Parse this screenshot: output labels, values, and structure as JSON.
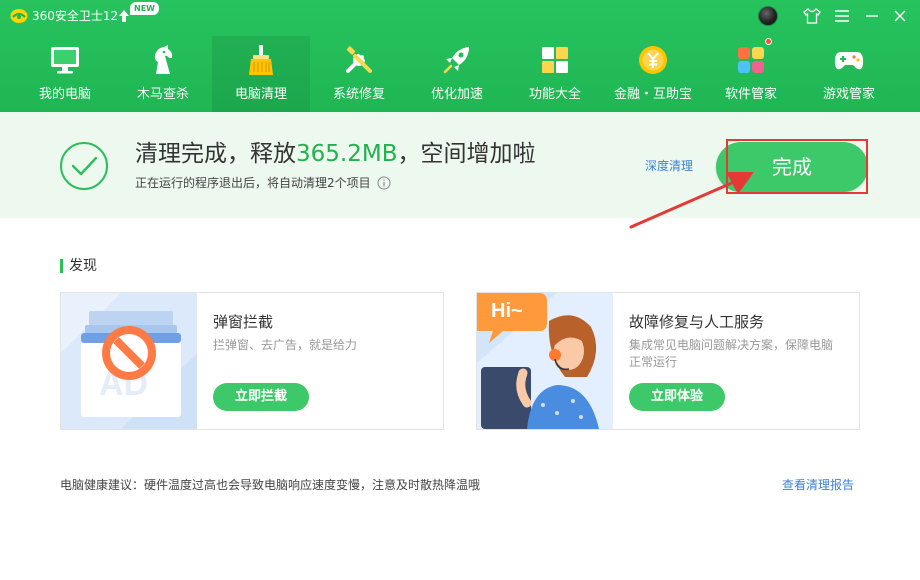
{
  "titlebar": {
    "app_title": "360安全卫士12",
    "new_badge": "NEW",
    "icons": [
      "logo-icon",
      "upgrade-icon",
      "avatar",
      "skin-icon",
      "menu-icon",
      "minimize-icon",
      "close-icon"
    ]
  },
  "nav": {
    "items": [
      {
        "label": "我的电脑",
        "icon": "computer-icon"
      },
      {
        "label": "木马查杀",
        "icon": "horse-icon"
      },
      {
        "label": "电脑清理",
        "icon": "broom-icon",
        "active": true
      },
      {
        "label": "系统修复",
        "icon": "tools-icon"
      },
      {
        "label": "优化加速",
        "icon": "rocket-icon"
      },
      {
        "label": "功能大全",
        "icon": "grid-icon"
      },
      {
        "label": "金融・互助宝",
        "icon": "coin-icon"
      },
      {
        "label": "软件管家",
        "icon": "apps-icon",
        "badge_dot": true
      },
      {
        "label": "游戏管家",
        "icon": "gamepad-icon"
      }
    ]
  },
  "result": {
    "title_prefix": "清理完成，释放",
    "freed_amount": "365.2MB",
    "title_suffix": "，空间增加啦",
    "subtitle": "正在运行的程序退出后，将自动清理2个项目",
    "deep_clean_link": "深度清理",
    "done_button": "完成"
  },
  "discover": {
    "section_title": "发现",
    "cards": [
      {
        "title": "弹窗拦截",
        "desc": "拦弹窗、去广告，就是给力",
        "button": "立即拦截",
        "image_text": "AD"
      },
      {
        "title": "故障修复与人工服务",
        "desc": "集成常见电脑问题解决方案，保障电脑正常运行",
        "button": "立即体验",
        "image_text": "Hi~"
      }
    ]
  },
  "footer": {
    "health_tip": "电脑健康建议：硬件温度过高也会导致电脑响应速度变慢，注意及时散热降温哦",
    "report_link": "查看清理报告"
  },
  "colors": {
    "header_green": "#22bb58",
    "accent_green": "#3dc86a",
    "highlight_green": "#22b14c",
    "link_blue": "#3d82cf",
    "annotation_red": "#e53935",
    "banner_bg": "#edf8ef"
  }
}
